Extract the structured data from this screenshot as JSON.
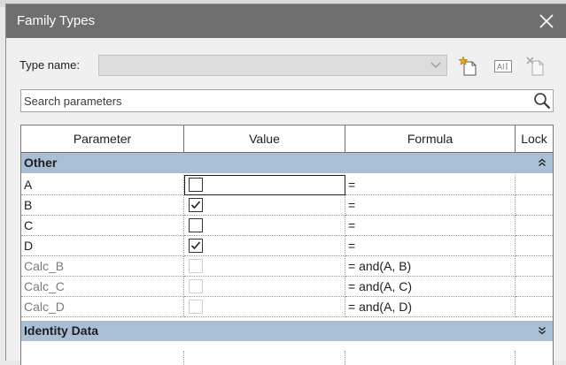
{
  "dialog": {
    "title": "Family Types"
  },
  "type_name": {
    "label": "Type name:",
    "value": ""
  },
  "search": {
    "placeholder": "Search parameters"
  },
  "grid": {
    "columns": [
      "Parameter",
      "Value",
      "Formula",
      "Lock"
    ],
    "groups": [
      {
        "label": "Other",
        "expanded": true,
        "rows": [
          {
            "name": "A",
            "checked": false,
            "formula": "=",
            "enabled": true
          },
          {
            "name": "B",
            "checked": true,
            "formula": "=",
            "enabled": true
          },
          {
            "name": "C",
            "checked": false,
            "formula": "=",
            "enabled": true
          },
          {
            "name": "D",
            "checked": true,
            "formula": "=",
            "enabled": true
          },
          {
            "name": "Calc_B",
            "checked": false,
            "formula": "= and(A, B)",
            "enabled": false
          },
          {
            "name": "Calc_C",
            "checked": false,
            "formula": "= and(A, C)",
            "enabled": false
          },
          {
            "name": "Calc_D",
            "checked": false,
            "formula": "= and(A, D)",
            "enabled": false
          }
        ]
      },
      {
        "label": "Identity Data",
        "expanded": false,
        "rows": []
      }
    ]
  },
  "icons": [
    "new-type-icon",
    "rename-type-icon",
    "delete-type-icon",
    "search-icon",
    "close-icon",
    "chevron-down-icon",
    "collapse-icon",
    "expand-icon"
  ],
  "colors": {
    "titlebar": "#6f6f6f",
    "group_header": "#a9bfd6",
    "disabled_text": "#7b7b7b"
  }
}
